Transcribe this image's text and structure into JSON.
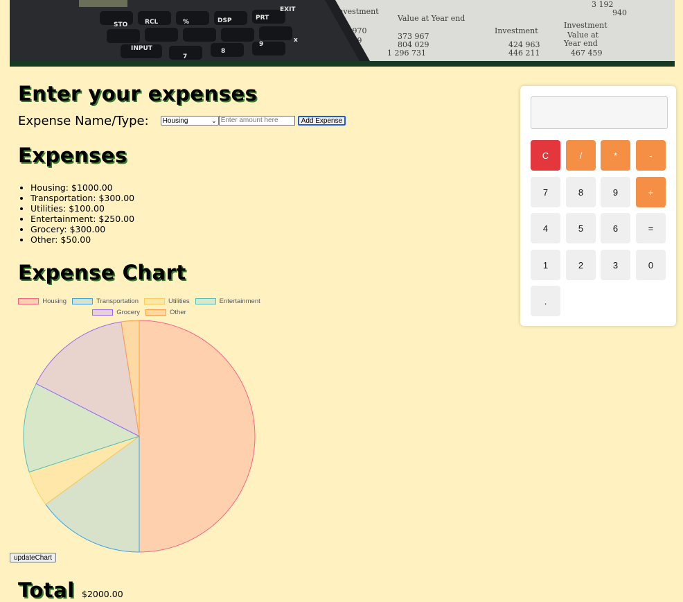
{
  "banner": {
    "alt": "calculator on financial statement"
  },
  "form": {
    "heading": "Enter your expenses",
    "label": "Expense Name/Type:",
    "selected_type": "Housing",
    "amount_placeholder": "Enter amount here",
    "add_button": "Add Expense"
  },
  "expenses": {
    "heading": "Expenses",
    "items": [
      "Housing: $1000.00",
      "Transportation: $300.00",
      "Utilities: $100.00",
      "Entertainment: $250.00",
      "Grocery: $300.00",
      "Other: $50.00"
    ]
  },
  "chart_section": {
    "heading": "Expense Chart",
    "update_button": "updateChart"
  },
  "chart_data": {
    "type": "pie",
    "title": "",
    "categories": [
      "Housing",
      "Transportation",
      "Utilities",
      "Entertainment",
      "Grocery",
      "Other"
    ],
    "values": [
      1000,
      300,
      100,
      250,
      300,
      50
    ],
    "fill_colors": [
      "#ffd0ad",
      "#d8e1c9",
      "#ffe6a9",
      "#d8e7c7",
      "#e8d4cc",
      "#fdd9a3"
    ],
    "border_colors": [
      "#ff6384",
      "#36a2eb",
      "#ffce56",
      "#4bc0c0",
      "#9966ff",
      "#ff9f40"
    ],
    "legend_position": "top"
  },
  "total": {
    "label": "Total",
    "value": "$2000.00"
  },
  "calculator": {
    "display": "",
    "keys": [
      "C",
      "/",
      "*",
      "-",
      "7",
      "8",
      "9",
      "+",
      "4",
      "5",
      "6",
      "=",
      "1",
      "2",
      "3",
      "0",
      "."
    ]
  },
  "colors": {
    "background": "#fff2c0",
    "accent_red": "#e3363d",
    "accent_orange": "#f58f45",
    "banner_bar": "#173a22"
  }
}
